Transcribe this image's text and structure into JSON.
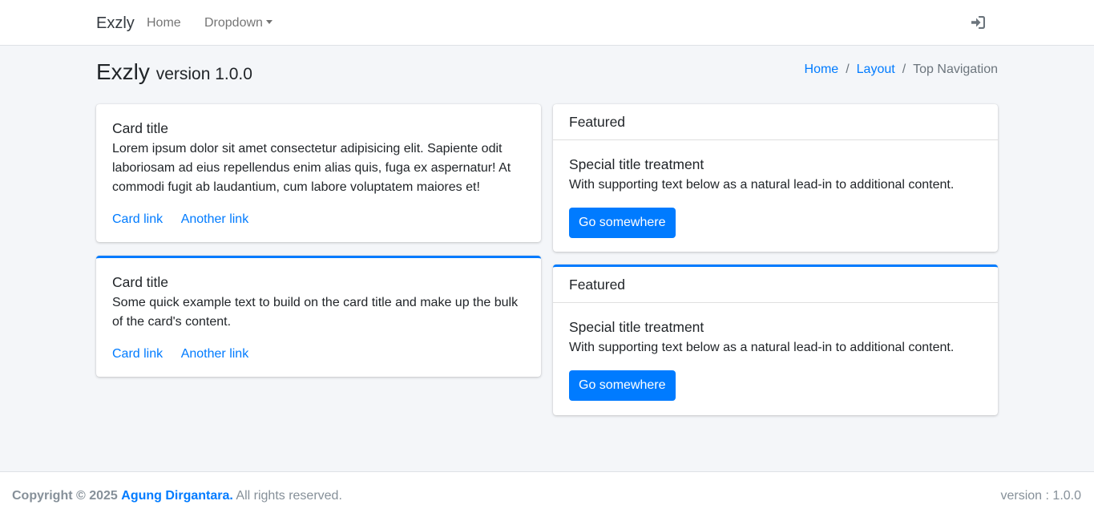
{
  "navbar": {
    "brand": "Exzly",
    "items": [
      {
        "label": "Home"
      },
      {
        "label": "Dropdown"
      }
    ],
    "login_icon": "sign-in-icon"
  },
  "header": {
    "title": "Exzly",
    "subtitle": "version 1.0.0",
    "breadcrumb": [
      {
        "label": "Home"
      },
      {
        "label": "Layout"
      },
      {
        "label": "Top Navigation"
      }
    ]
  },
  "cards": [
    {
      "title": "Card title",
      "text": "Lorem ipsum dolor sit amet consectetur adipisicing elit. Sapiente odit laboriosam ad eius repellendus enim alias quis, fuga ex aspernatur! At commodi fugit ab laudantium, cum labore voluptatem maiores et!",
      "links": [
        "Card link",
        "Another link"
      ]
    },
    {
      "title": "Card title",
      "text": "Some quick example text to build on the card title and make up the bulk of the card's content.",
      "links": [
        "Card link",
        "Another link"
      ]
    },
    {
      "header": "Featured",
      "title": "Special title treatment",
      "text": "With supporting text below as a natural lead-in to additional content.",
      "button": "Go somewhere"
    },
    {
      "header": "Featured",
      "title": "Special title treatment",
      "text": "With supporting text below as a natural lead-in to additional content.",
      "button": "Go somewhere"
    }
  ],
  "footer": {
    "copyright_prefix": "Copyright © 2025",
    "author": "Agung Dirgantara.",
    "rights": "All rights reserved.",
    "version": "version : 1.0.0"
  },
  "colors": {
    "accent": "#007bff",
    "background": "#f4f6f9"
  }
}
